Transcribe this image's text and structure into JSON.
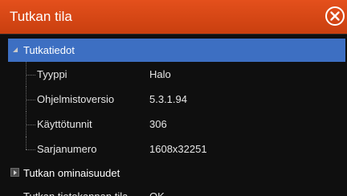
{
  "dialog": {
    "title": "Tutkan tila",
    "close_icon": "circle-x-icon"
  },
  "tree": {
    "groups": [
      {
        "label": "Tutkatiedot",
        "expanded": true,
        "selected": true,
        "rows": [
          {
            "key": "Tyyppi",
            "value": "Halo"
          },
          {
            "key": "Ohjelmistoversio",
            "value": "5.3.1.94"
          },
          {
            "key": "Käyttötunnit",
            "value": "306"
          },
          {
            "key": "Sarjanumero",
            "value": "1608x32251"
          }
        ]
      },
      {
        "label": "Tutkan ominaisuudet",
        "expanded": false,
        "selected": false
      }
    ],
    "partial_row": {
      "key": "Tutkan tietokannan tila",
      "value": "OK"
    }
  },
  "colors": {
    "titlebar": "#d9491a",
    "selection": "#3d6fc2",
    "background": "#0f0f0f"
  }
}
